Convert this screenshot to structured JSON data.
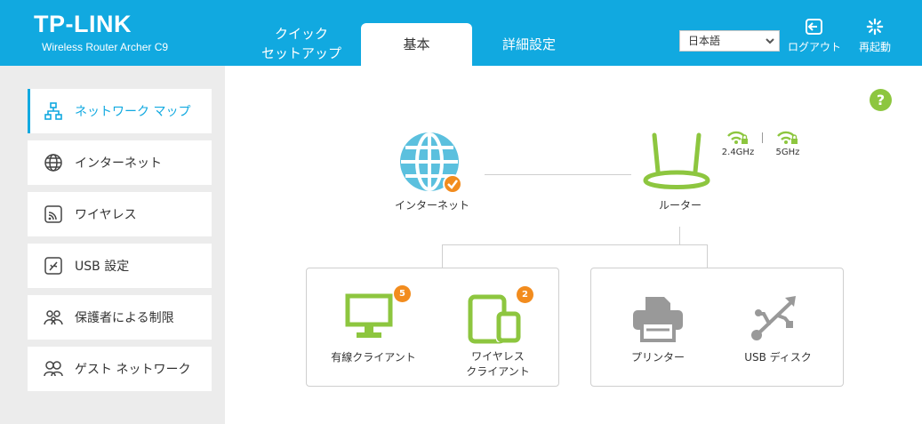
{
  "header": {
    "brand": "TP-LINK",
    "model": "Wireless Router Archer C9",
    "tabs": {
      "quick_line1": "クイック",
      "quick_line2": "セットアップ",
      "basic": "基本",
      "advanced": "詳細設定"
    },
    "language": "日本語",
    "logout": "ログアウト",
    "reboot": "再起動"
  },
  "sidebar": {
    "items": [
      {
        "label": "ネットワーク マップ",
        "icon": "network-map-icon",
        "active": true
      },
      {
        "label": "インターネット",
        "icon": "globe-icon"
      },
      {
        "label": "ワイヤレス",
        "icon": "wireless-icon"
      },
      {
        "label": "USB 設定",
        "icon": "usb-icon"
      },
      {
        "label": "保護者による制限",
        "icon": "parental-icon"
      },
      {
        "label": "ゲスト ネットワーク",
        "icon": "guest-icon"
      }
    ]
  },
  "map": {
    "internet_label": "インターネット",
    "router_label": "ルーター",
    "band_24": "2.4GHz",
    "band_5": "5GHz",
    "wired_clients_label": "有線クライアント",
    "wired_clients_count": "5",
    "wireless_clients_line1": "ワイヤレス",
    "wireless_clients_line2": "クライアント",
    "wireless_clients_count": "2",
    "printer_label": "プリンター",
    "usb_disk_label": "USB ディスク"
  },
  "help_label": "?",
  "colors": {
    "header_bg": "#11a9e0",
    "accent_green": "#8dc63f",
    "badge_orange": "#f28c1e",
    "sidebar_bg": "#ececec"
  }
}
